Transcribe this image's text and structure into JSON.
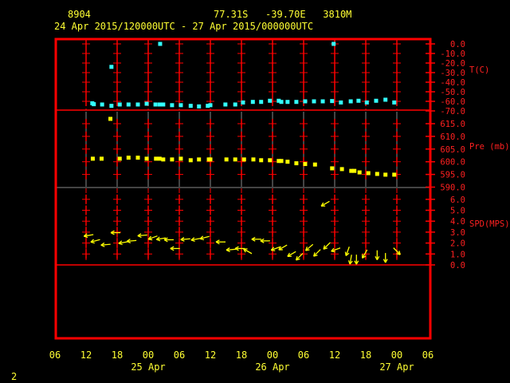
{
  "header": {
    "station_id": "8904",
    "location": "77.31S   -39.70E   3810M",
    "period": "24 Apr 2015/120000UTC - 27 Apr 2015/000000UTC"
  },
  "footer": {
    "page_number": "2"
  },
  "colors": {
    "frame": "#ff0000",
    "temperature": "#33ffff",
    "pressure": "#ffff00",
    "wind": "#ffff00",
    "text": "#ffff33",
    "axis_text": "#ff2020"
  },
  "chart_data": [
    {
      "type": "scatter",
      "name": "temperature",
      "ylabel": "T(C)",
      "ylim": [
        -70,
        0
      ],
      "yticks": [
        "0.0",
        "-10.0",
        "-20.0",
        "-30.0",
        "-40.0",
        "-50.0",
        "-60.0",
        "-70.0"
      ],
      "x_unit": "hours since 24 Apr 06 UTC",
      "points": [
        [
          7.2,
          -62
        ],
        [
          7.5,
          -63
        ],
        [
          9.1,
          -63.3
        ],
        [
          10.9,
          -64.7
        ],
        [
          10.9,
          -24
        ],
        [
          12.5,
          -63.3
        ],
        [
          14.2,
          -63.3
        ],
        [
          16.0,
          -63.3
        ],
        [
          17.7,
          -62.5
        ],
        [
          19.4,
          -63.3
        ],
        [
          20.2,
          -63.3
        ],
        [
          20.3,
          0
        ],
        [
          20.9,
          -63.3
        ],
        [
          22.6,
          -64
        ],
        [
          24.3,
          -64
        ],
        [
          26.2,
          -64.7
        ],
        [
          27.8,
          -65.3
        ],
        [
          29.5,
          -64.7
        ],
        [
          30.0,
          -64
        ],
        [
          32.9,
          -63.3
        ],
        [
          34.8,
          -63.3
        ],
        [
          36.3,
          -61.2
        ],
        [
          38.2,
          -60.6
        ],
        [
          39.8,
          -60.6
        ],
        [
          41.5,
          -59.4
        ],
        [
          43.2,
          -59.4
        ],
        [
          43.7,
          -60.6
        ],
        [
          44.9,
          -60.6
        ],
        [
          46.6,
          -60.6
        ],
        [
          48.3,
          -60
        ],
        [
          50.0,
          -60
        ],
        [
          51.7,
          -60
        ],
        [
          53.5,
          -59.7
        ],
        [
          53.8,
          0
        ],
        [
          55.2,
          -61.2
        ],
        [
          57.1,
          -60
        ],
        [
          58.6,
          -59.4
        ],
        [
          60.2,
          -61.2
        ],
        [
          62.0,
          -59.4
        ],
        [
          63.8,
          -58.3
        ],
        [
          65.5,
          -61.2
        ]
      ]
    },
    {
      "type": "scatter",
      "name": "pressure",
      "ylabel": "Pre (mb)",
      "ylim": [
        590,
        615
      ],
      "yticks": [
        "615.0",
        "610.0",
        "605.0",
        "600.0",
        "595.0",
        "590.0"
      ],
      "x_unit": "hours since 24 Apr 06 UTC",
      "points": [
        [
          7.3,
          601.2
        ],
        [
          9.0,
          601.2
        ],
        [
          10.7,
          616.9
        ],
        [
          12.5,
          601.2
        ],
        [
          14.2,
          601.6
        ],
        [
          16.0,
          601.6
        ],
        [
          17.7,
          601.2
        ],
        [
          19.5,
          601.2
        ],
        [
          20.2,
          601.2
        ],
        [
          20.9,
          600.9
        ],
        [
          22.6,
          600.9
        ],
        [
          24.3,
          601.2
        ],
        [
          26.2,
          600.6
        ],
        [
          27.8,
          600.9
        ],
        [
          29.7,
          600.9
        ],
        [
          30.0,
          600.9
        ],
        [
          33.1,
          600.9
        ],
        [
          34.8,
          600.9
        ],
        [
          36.5,
          600.9
        ],
        [
          38.3,
          600.9
        ],
        [
          39.8,
          600.6
        ],
        [
          41.5,
          600.6
        ],
        [
          43.2,
          600.3
        ],
        [
          43.7,
          600.3
        ],
        [
          44.9,
          600
        ],
        [
          46.6,
          599.4
        ],
        [
          48.3,
          599.1
        ],
        [
          50.2,
          598.9
        ],
        [
          53.5,
          597.4
        ],
        [
          55.4,
          597.1
        ],
        [
          57.2,
          596.4
        ],
        [
          57.8,
          596.4
        ],
        [
          58.8,
          595.8
        ],
        [
          60.5,
          595.5
        ],
        [
          62.2,
          595.2
        ],
        [
          63.8,
          594.9
        ],
        [
          65.5,
          594.9
        ]
      ]
    },
    {
      "type": "scatter",
      "name": "wind",
      "ylabel": "SPD(MPS)",
      "ylim": [
        0,
        6
      ],
      "yticks": [
        "6.0",
        "5.0",
        "4.0",
        "3.0",
        "2.0",
        "1.0",
        "0.0"
      ],
      "x_unit": "hours since 24 Apr 06 UTC",
      "point_format": "[hour, speed_mps, arrow_direction_deg_ccw_from_east]",
      "points": [
        [
          6.5,
          2.7,
          190
        ],
        [
          7.8,
          2.2,
          195
        ],
        [
          9.8,
          1.85,
          185
        ],
        [
          11.7,
          2.95,
          180
        ],
        [
          13.2,
          2.05,
          190
        ],
        [
          14.8,
          2.2,
          185
        ],
        [
          16.9,
          2.7,
          185
        ],
        [
          18.9,
          2.5,
          200
        ],
        [
          20.5,
          2.4,
          190
        ],
        [
          22.0,
          2.3,
          180
        ],
        [
          23.2,
          1.5,
          180
        ],
        [
          25.2,
          2.35,
          185
        ],
        [
          27.2,
          2.35,
          190
        ],
        [
          28.9,
          2.5,
          195
        ],
        [
          32.0,
          2.1,
          180
        ],
        [
          34.0,
          1.4,
          185
        ],
        [
          35.7,
          1.5,
          180
        ],
        [
          37.2,
          1.25,
          150
        ],
        [
          38.9,
          2.35,
          180
        ],
        [
          40.6,
          2.2,
          180
        ],
        [
          42.6,
          1.5,
          200
        ],
        [
          44.0,
          1.6,
          210
        ],
        [
          45.7,
          1.0,
          210
        ],
        [
          47.2,
          0.75,
          225
        ],
        [
          49.1,
          1.6,
          220
        ],
        [
          50.6,
          1.1,
          225
        ],
        [
          52.2,
          5.6,
          210
        ],
        [
          52.5,
          1.75,
          225
        ],
        [
          54.2,
          1.4,
          200
        ],
        [
          56.5,
          1.25,
          250
        ],
        [
          57.1,
          0.5,
          260
        ],
        [
          58.2,
          0.5,
          270
        ],
        [
          59.8,
          1.0,
          240
        ],
        [
          62.2,
          0.9,
          270
        ],
        [
          63.8,
          0.65,
          270
        ],
        [
          66.0,
          1.25,
          315
        ]
      ]
    }
  ],
  "x_axis": {
    "tick_labels": [
      "06",
      "12",
      "18",
      "00",
      "06",
      "12",
      "18",
      "00",
      "06",
      "12",
      "18",
      "00",
      "06"
    ],
    "date_labels": [
      {
        "label": "25 Apr",
        "hour": 18
      },
      {
        "label": "26 Apr",
        "hour": 42
      },
      {
        "label": "27 Apr",
        "hour": 66
      }
    ],
    "range_hours": [
      0,
      72
    ]
  }
}
